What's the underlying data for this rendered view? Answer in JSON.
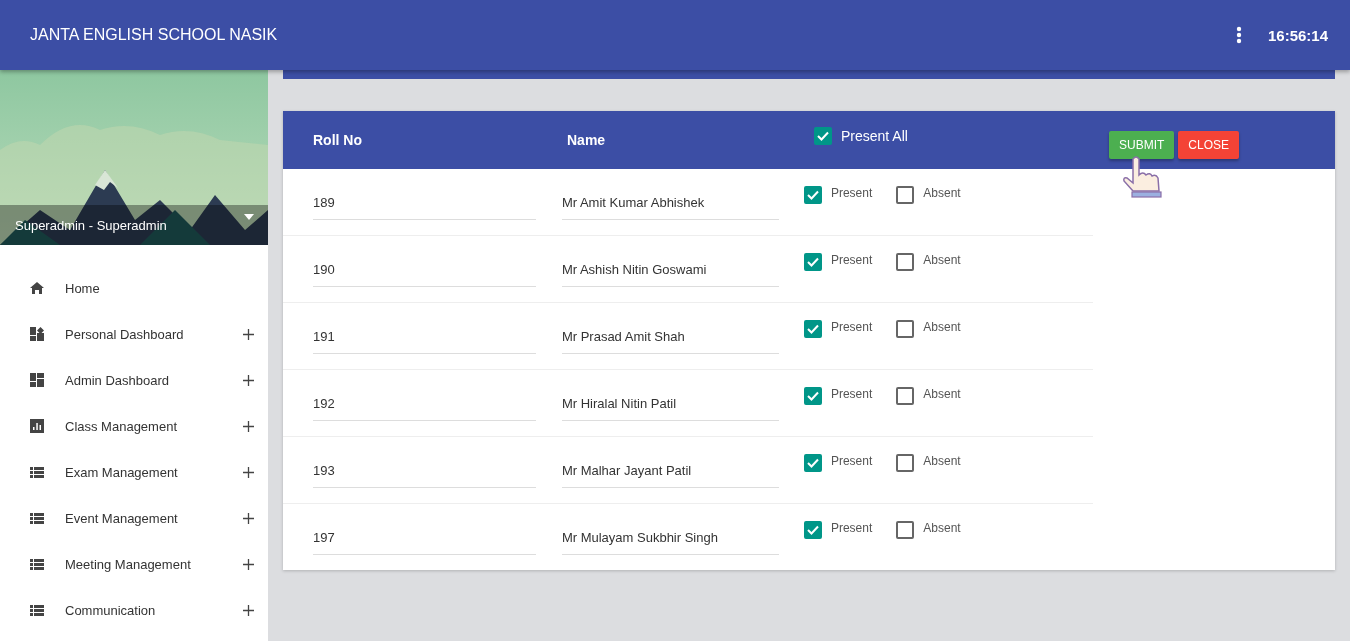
{
  "header": {
    "title": "JANTA ENGLISH SCHOOL NASIK",
    "time": "16:56:14"
  },
  "profile": {
    "name": "Superadmin - Superadmin"
  },
  "sidebar": {
    "items": [
      {
        "label": "Home",
        "expandable": false
      },
      {
        "label": "Personal Dashboard",
        "expandable": true
      },
      {
        "label": "Admin Dashboard",
        "expandable": true
      },
      {
        "label": "Class Management",
        "expandable": true
      },
      {
        "label": "Exam Management",
        "expandable": true
      },
      {
        "label": "Event Management",
        "expandable": true
      },
      {
        "label": "Meeting Management",
        "expandable": true
      },
      {
        "label": "Communication",
        "expandable": true
      }
    ]
  },
  "table": {
    "columns": [
      "Roll No",
      "Name"
    ],
    "present_all": {
      "label": "Present All",
      "checked": true
    },
    "buttons": {
      "submit": "SUBMIT",
      "close": "CLOSE"
    },
    "rows": [
      {
        "roll_no": "189",
        "name": "Mr Amit Kumar Abhishek",
        "present": {
          "label": "Present",
          "checked": true
        },
        "absent": {
          "label": "Absent",
          "checked": false
        }
      },
      {
        "roll_no": "190",
        "name": "Mr Ashish Nitin Goswami",
        "present": {
          "label": "Present",
          "checked": true
        },
        "absent": {
          "label": "Absent",
          "checked": false
        }
      },
      {
        "roll_no": "191",
        "name": "Mr Prasad Amit Shah",
        "present": {
          "label": "Present",
          "checked": true
        },
        "absent": {
          "label": "Absent",
          "checked": false
        }
      },
      {
        "roll_no": "192",
        "name": "Mr Hiralal Nitin Patil",
        "present": {
          "label": "Present",
          "checked": true
        },
        "absent": {
          "label": "Absent",
          "checked": false
        }
      },
      {
        "roll_no": "193",
        "name": "Mr Malhar Jayant Patil",
        "present": {
          "label": "Present",
          "checked": true
        },
        "absent": {
          "label": "Absent",
          "checked": false
        }
      },
      {
        "roll_no": "197",
        "name": "Mr Mulayam Sukbhir Singh",
        "present": {
          "label": "Present",
          "checked": true
        },
        "absent": {
          "label": "Absent",
          "checked": false
        }
      }
    ]
  }
}
